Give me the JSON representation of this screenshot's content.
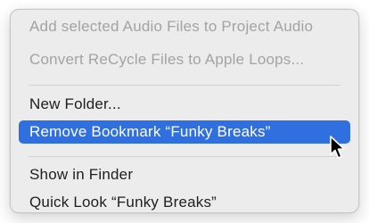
{
  "context_menu": {
    "items": [
      {
        "label": "Add selected Audio Files to Project Audio",
        "enabled": false
      },
      {
        "label": "Convert ReCycle Files to Apple Loops...",
        "enabled": false
      },
      {
        "label": "New Folder...",
        "enabled": true
      },
      {
        "label": "Remove Bookmark “Funky Breaks”",
        "enabled": true,
        "highlighted": true
      },
      {
        "label": "Show in Finder",
        "enabled": true
      },
      {
        "label": "Quick Look “Funky Breaks”",
        "enabled": true
      }
    ]
  },
  "cursor": {
    "icon": "arrow-pointer-icon"
  },
  "colors": {
    "highlight": "#2f6fe0",
    "menu_background": "#ececec",
    "disabled_text": "#a3a3a3"
  }
}
